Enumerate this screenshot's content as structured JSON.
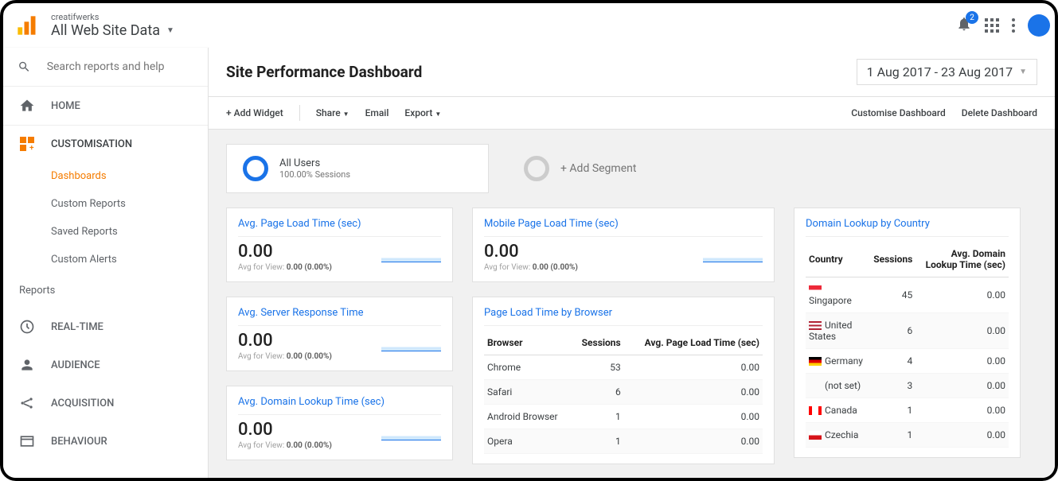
{
  "header": {
    "account_name": "creatifwerks",
    "view_name": "All Web Site Data",
    "notification_count": "2"
  },
  "sidebar": {
    "search_placeholder": "Search reports and help",
    "home": "HOME",
    "customisation": "CUSTOMISATION",
    "sub": {
      "dashboards": "Dashboards",
      "custom_reports": "Custom Reports",
      "saved_reports": "Saved Reports",
      "custom_alerts": "Custom Alerts"
    },
    "reports_label": "Reports",
    "realtime": "REAL-TIME",
    "audience": "AUDIENCE",
    "acquisition": "ACQUISITION",
    "behaviour": "BEHAVIOUR"
  },
  "page": {
    "title": "Site Performance Dashboard",
    "date_range": "1 Aug 2017 - 23 Aug 2017"
  },
  "toolbar": {
    "add_widget": "+ Add Widget",
    "share": "Share",
    "email": "Email",
    "export": "Export",
    "customise": "Customise Dashboard",
    "delete": "Delete Dashboard"
  },
  "segments": {
    "all_users_title": "All Users",
    "all_users_sub": "100.00% Sessions",
    "add_segment": "+ Add Segment"
  },
  "widgets": {
    "avg_page_load": {
      "title": "Avg. Page Load Time (sec)",
      "value": "0.00",
      "avg_label": "Avg for View:",
      "avg_val": "0.00 (0.00%)"
    },
    "avg_server_response": {
      "title": "Avg. Server Response Time",
      "value": "0.00",
      "avg_label": "Avg for View:",
      "avg_val": "0.00 (0.00%)"
    },
    "avg_domain_lookup": {
      "title": "Avg. Domain Lookup Time (sec)",
      "value": "0.00",
      "avg_label": "Avg for View:",
      "avg_val": "0.00 (0.00%)"
    },
    "mobile_page_load": {
      "title": "Mobile Page Load Time (sec)",
      "value": "0.00",
      "avg_label": "Avg for View:",
      "avg_val": "0.00 (0.00%)"
    },
    "browser_table": {
      "title": "Page Load Time by Browser",
      "headers": {
        "browser": "Browser",
        "sessions": "Sessions",
        "avg": "Avg. Page Load Time (sec)"
      },
      "rows": [
        {
          "browser": "Chrome",
          "sessions": "53",
          "avg": "0.00"
        },
        {
          "browser": "Safari",
          "sessions": "6",
          "avg": "0.00"
        },
        {
          "browser": "Android Browser",
          "sessions": "1",
          "avg": "0.00"
        },
        {
          "browser": "Opera",
          "sessions": "1",
          "avg": "0.00"
        }
      ]
    },
    "country_table": {
      "title": "Domain Lookup by Country",
      "headers": {
        "country": "Country",
        "sessions": "Sessions",
        "avg": "Avg. Domain Lookup Time (sec)"
      },
      "rows": [
        {
          "flag": "sg",
          "country": "Singapore",
          "sessions": "45",
          "avg": "0.00"
        },
        {
          "flag": "us",
          "country": "United States",
          "sessions": "6",
          "avg": "0.00"
        },
        {
          "flag": "de",
          "country": "Germany",
          "sessions": "4",
          "avg": "0.00"
        },
        {
          "flag": "none",
          "country": "(not set)",
          "sessions": "3",
          "avg": "0.00"
        },
        {
          "flag": "ca",
          "country": "Canada",
          "sessions": "1",
          "avg": "0.00"
        },
        {
          "flag": "cz",
          "country": "Czechia",
          "sessions": "1",
          "avg": "0.00"
        }
      ]
    }
  }
}
